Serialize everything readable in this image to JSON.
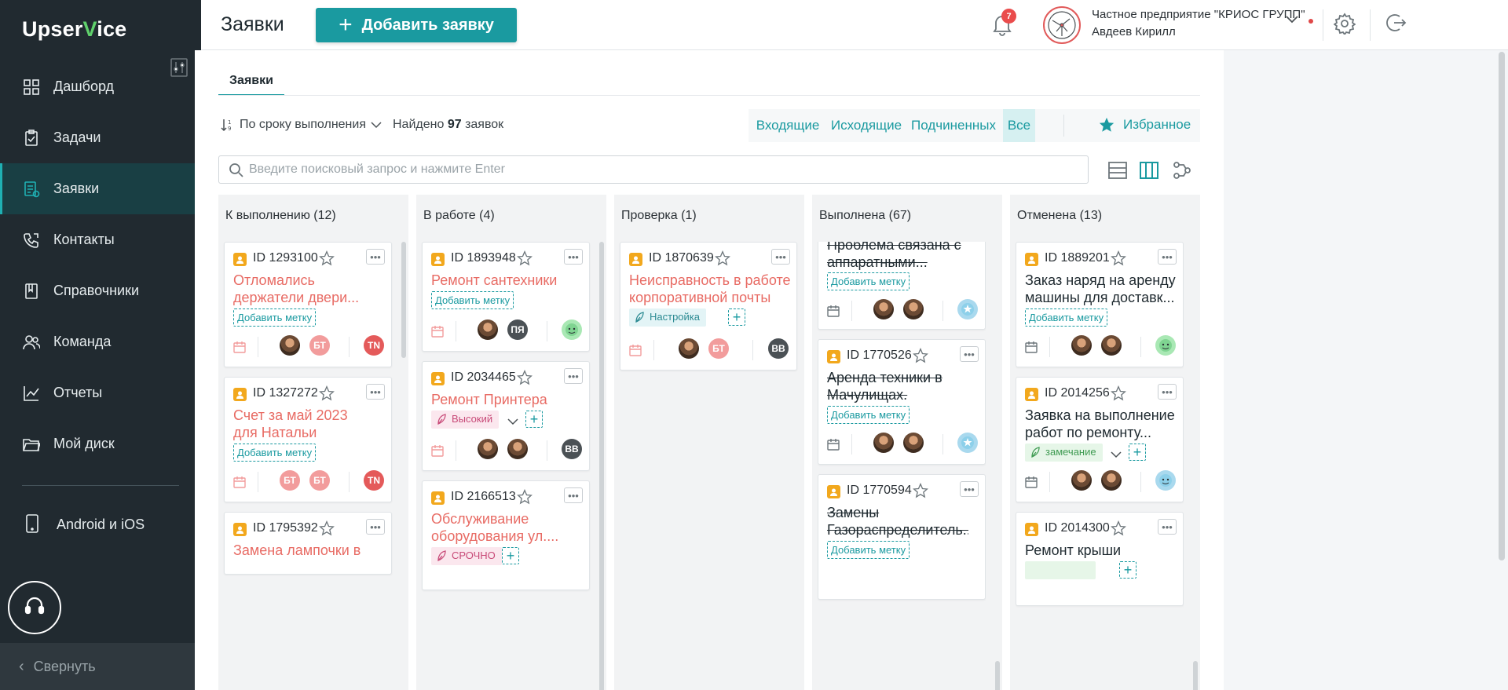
{
  "app": {
    "logo_left": "Upser",
    "logo_v": "V",
    "logo_right": "ice"
  },
  "sidebar": {
    "items": [
      {
        "label": "Дашборд",
        "icon": "dashboard-icon"
      },
      {
        "label": "Задачи",
        "icon": "tasks-icon"
      },
      {
        "label": "Заявки",
        "icon": "requests-icon",
        "active": true
      },
      {
        "label": "Контакты",
        "icon": "contacts-icon"
      },
      {
        "label": "Справочники",
        "icon": "book-icon"
      },
      {
        "label": "Команда",
        "icon": "team-icon"
      },
      {
        "label": "Отчеты",
        "icon": "reports-icon"
      },
      {
        "label": "Мой диск",
        "icon": "folder-icon"
      }
    ],
    "mobile_label": "Android и iOS",
    "collapse_label": "Свернуть"
  },
  "header": {
    "title": "Заявки",
    "add_button": "Добавить заявку",
    "notifications_count": "7",
    "company": "Частное предприятие \"КРИОС ГРУПП\"",
    "user": "Авдеев Кирилл"
  },
  "main": {
    "tab": "Заявки",
    "sort_label": "По сроку выполнения",
    "found_prefix": "Найдено",
    "found_count": "97",
    "found_suffix": "заявок",
    "filters": [
      "Входящие",
      "Исходящие",
      "Подчиненных",
      "Все"
    ],
    "active_filter": "Все",
    "favorite": "Избранное",
    "search_placeholder": "Введите поисковый запрос и нажмите Enter"
  },
  "colors": {
    "accent": "#1a9aa0",
    "sidebar": "#212a30",
    "overdue_title": "#e86b64"
  },
  "columns": [
    {
      "title": "К выполнению (12)",
      "cards": [
        {
          "id": "ID 1293100",
          "title": "Отломались держатели двери...",
          "add_tag": "Добавить метку",
          "avatars": [
            "photo",
            "БТ"
          ],
          "assignee": "TN"
        },
        {
          "id": "ID 1327272",
          "title": "Счет за май 2023 для Натальи",
          "add_tag": "Добавить метку",
          "avatars": [
            "БТ",
            "БТ"
          ],
          "assignee": "TN"
        },
        {
          "id": "ID 1795392",
          "title": "Замена лампочки в"
        }
      ]
    },
    {
      "title": "В работе (4)",
      "cards": [
        {
          "id": "ID 1893948",
          "title": "Ремонт сантехники",
          "add_tag": "Добавить метку",
          "avatars": [
            "photo",
            "ПЯ"
          ],
          "assignee": "green-face"
        },
        {
          "id": "ID 2034465",
          "title": "Ремонт Принтера",
          "tag": "Высокий",
          "avatars": [
            "photo",
            "photo"
          ],
          "assignee": "BB"
        },
        {
          "id": "ID 2166513",
          "title": "Обслуживание оборудования ул....",
          "tag": "СРОЧНО"
        }
      ]
    },
    {
      "title": "Проверка (1)",
      "cards": [
        {
          "id": "ID 1870639",
          "title": "Неисправность в работе корпоративной почты",
          "tag": "Настройка",
          "avatars": [
            "photo",
            "БТ"
          ],
          "assignee": "BB"
        }
      ]
    },
    {
      "title": "Выполнена (67)",
      "cards": [
        {
          "id": "",
          "title": "Проблема связана с аппаратными...",
          "add_tag": "Добавить метку"
        },
        {
          "id": "ID 1770526",
          "title": "Аренда техники в Мачулищах.",
          "add_tag": "Добавить метку"
        },
        {
          "id": "ID 1770594",
          "title": "Замены Газораспределитель...",
          "add_tag": "Добавить метку"
        }
      ]
    },
    {
      "title": "Отменена (13)",
      "cards": [
        {
          "id": "ID 1889201",
          "title": "Заказ наряд на аренду машины для доставк...",
          "add_tag": "Добавить метку"
        },
        {
          "id": "ID 2014256",
          "title": "Заявка на выполнение работ по ремонту...",
          "tag": "замечание"
        },
        {
          "id": "ID 2014300",
          "title": "Ремонт крыши"
        }
      ]
    }
  ]
}
